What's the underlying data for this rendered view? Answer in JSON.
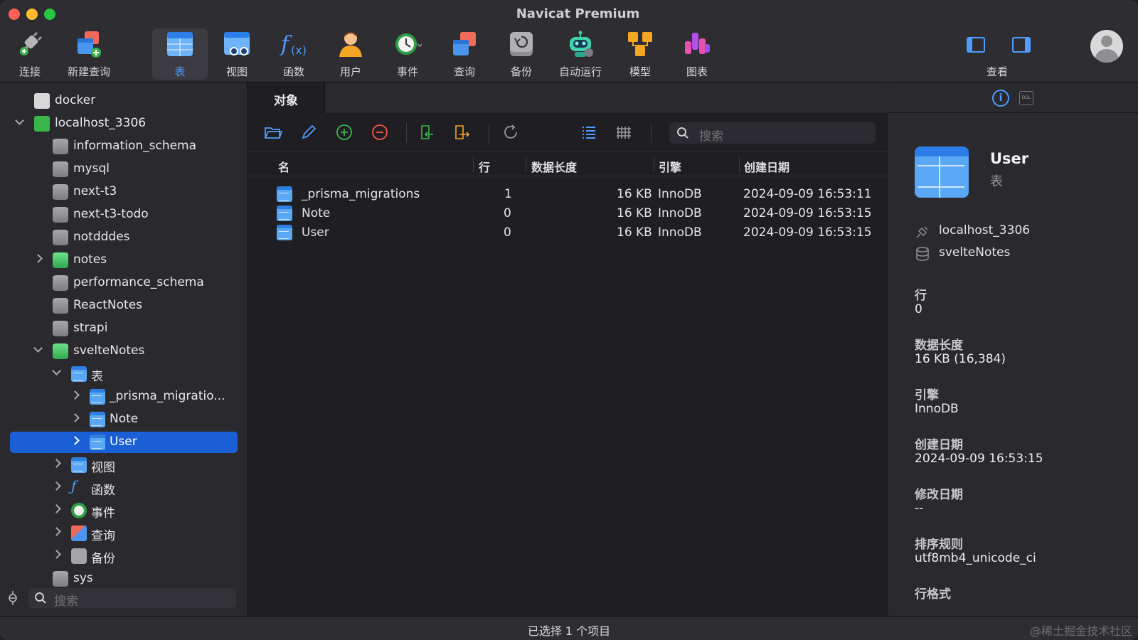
{
  "app": {
    "title": "Navicat Premium"
  },
  "toolbar": {
    "items": [
      {
        "label": "连接",
        "icon": "connect-plug-icon"
      },
      {
        "label": "新建查询",
        "icon": "new-query-icon"
      },
      {
        "label": "表",
        "icon": "table-icon",
        "active": true
      },
      {
        "label": "视图",
        "icon": "view-icon"
      },
      {
        "label": "函数",
        "icon": "function-icon"
      },
      {
        "label": "用户",
        "icon": "user-icon"
      },
      {
        "label": "事件",
        "icon": "event-clock-icon"
      },
      {
        "label": "查询",
        "icon": "query-icon"
      },
      {
        "label": "备份",
        "icon": "backup-icon"
      },
      {
        "label": "自动运行",
        "icon": "automation-robot-icon"
      },
      {
        "label": "模型",
        "icon": "model-icon"
      },
      {
        "label": "图表",
        "icon": "chart-icon"
      }
    ],
    "view_label": "查看"
  },
  "sidebar": {
    "rows": [
      {
        "label": "docker"
      },
      {
        "label": "localhost_3306"
      },
      {
        "label": "information_schema"
      },
      {
        "label": "mysql"
      },
      {
        "label": "next-t3"
      },
      {
        "label": "next-t3-todo"
      },
      {
        "label": "notdddes"
      },
      {
        "label": "notes"
      },
      {
        "label": "performance_schema"
      },
      {
        "label": "ReactNotes"
      },
      {
        "label": "strapi"
      },
      {
        "label": "svelteNotes"
      },
      {
        "label": "表"
      },
      {
        "label": "_prisma_migratio..."
      },
      {
        "label": "Note"
      },
      {
        "label": "User"
      },
      {
        "label": "视图"
      },
      {
        "label": "函数"
      },
      {
        "label": "事件"
      },
      {
        "label": "查询"
      },
      {
        "label": "备份"
      },
      {
        "label": "sys"
      }
    ],
    "search_placeholder": "搜索"
  },
  "main": {
    "tab": "对象",
    "search_placeholder": "搜索",
    "columns": [
      "名",
      "行",
      "数据长度",
      "引擎",
      "创建日期"
    ],
    "rows": [
      {
        "name": "_prisma_migrations",
        "rows": "1",
        "size": "16 KB",
        "engine": "InnoDB",
        "created": "2024-09-09 16:53:11"
      },
      {
        "name": "Note",
        "rows": "0",
        "size": "16 KB",
        "engine": "InnoDB",
        "created": "2024-09-09 16:53:15"
      },
      {
        "name": "User",
        "rows": "0",
        "size": "16 KB",
        "engine": "InnoDB",
        "created": "2024-09-09 16:53:15"
      }
    ]
  },
  "inspector": {
    "ddl_label": "DDL",
    "name": "User",
    "type": "表",
    "connection": "localhost_3306",
    "database": "svelteNotes",
    "props": [
      {
        "key": "行",
        "value": "0"
      },
      {
        "key": "数据长度",
        "value": "16 KB (16,384)"
      },
      {
        "key": "引擎",
        "value": "InnoDB"
      },
      {
        "key": "创建日期",
        "value": "2024-09-09 16:53:15"
      },
      {
        "key": "修改日期",
        "value": "--"
      },
      {
        "key": "排序规则",
        "value": "utf8mb4_unicode_ci"
      },
      {
        "key": "行格式",
        "value": ""
      }
    ]
  },
  "status": {
    "text": "已选择 1 个项目",
    "watermark": "@稀土掘金技术社区"
  },
  "colors": {
    "accent": "#1a5fd6",
    "link_blue": "#4f9cff"
  }
}
